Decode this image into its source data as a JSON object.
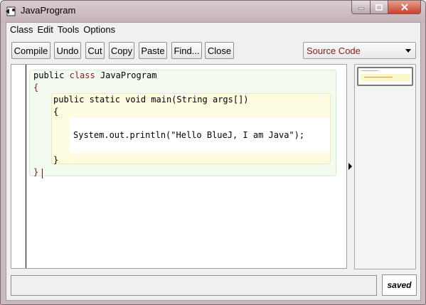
{
  "window": {
    "title": "JavaProgram"
  },
  "menu": [
    "Class",
    "Edit",
    "Tools",
    "Options"
  ],
  "toolbar": {
    "buttons": [
      "Compile",
      "Undo",
      "Cut",
      "Copy",
      "Paste",
      "Find...",
      "Close"
    ]
  },
  "view_selector": {
    "selected": "Source Code"
  },
  "code": {
    "line1_kw1": "public",
    "line1_kw2": "class",
    "line1_name": "JavaProgram",
    "line2": "{",
    "line3": "public static void main(String args[])",
    "line4": "{",
    "line5": "System.out.println(\"Hello BlueJ, I am Java\");",
    "line6": "}",
    "line7": "}"
  },
  "status": {
    "message": "",
    "state": "saved"
  },
  "colors": {
    "keyword": "#8b1a1a",
    "class_scope": "#f3fbf1",
    "method_scope": "#fdfbe0"
  }
}
